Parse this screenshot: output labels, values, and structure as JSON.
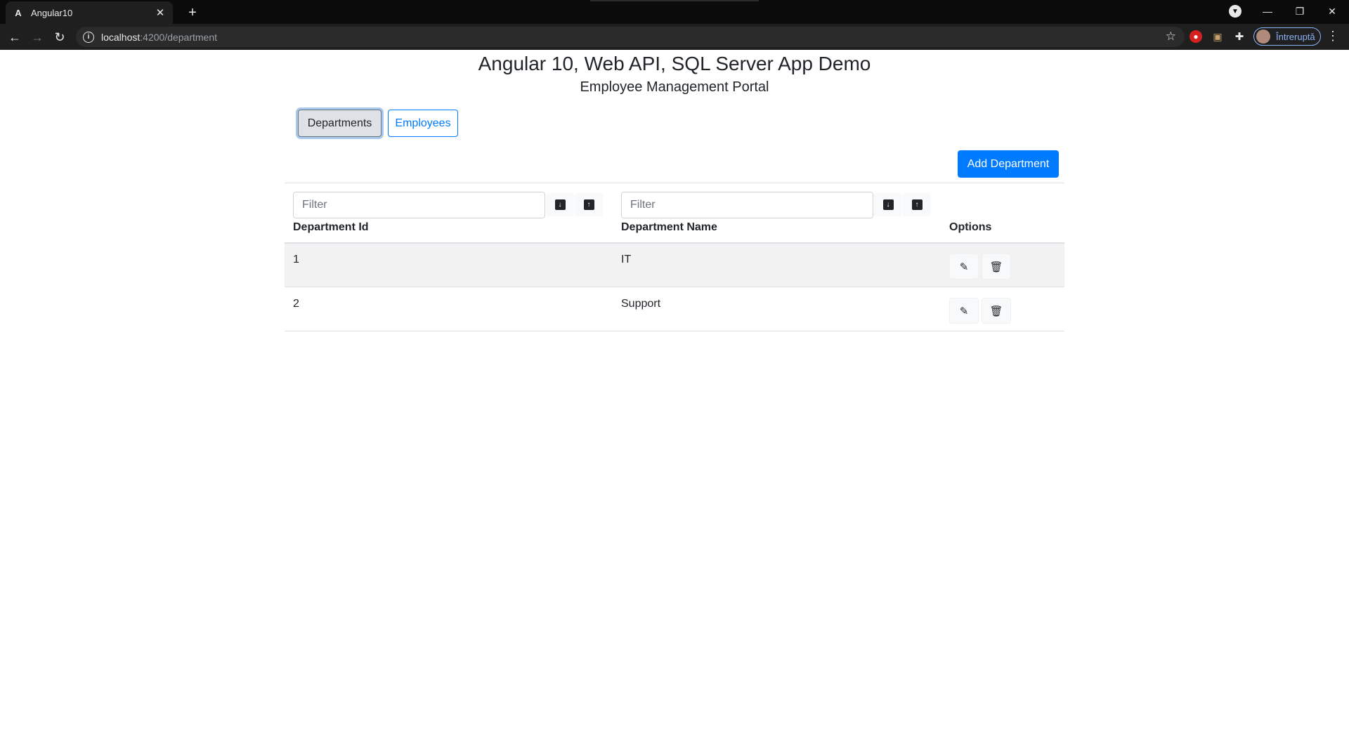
{
  "browser": {
    "tab_title": "Angular10",
    "tab_favicon": "A",
    "url_host": "localhost",
    "url_path": ":4200/department",
    "profile_label": "Întreruptă"
  },
  "page": {
    "title": "Angular 10, Web API, SQL Server App Demo",
    "subtitle": "Employee Management Portal",
    "nav": {
      "departments": "Departments",
      "employees": "Employees"
    },
    "add_button": "Add Department",
    "filters": {
      "id_placeholder": "Filter",
      "name_placeholder": "Filter"
    },
    "columns": {
      "id": "Department Id",
      "name": "Department Name",
      "options": "Options"
    },
    "rows": [
      {
        "id": "1",
        "name": "IT"
      },
      {
        "id": "2",
        "name": "Support"
      }
    ]
  },
  "colors": {
    "primary": "#007bff",
    "chrome_bg": "#1f1f1f",
    "stripe": "#f2f2f2"
  },
  "icons": {
    "sort_desc": "arrow-down-icon",
    "sort_asc": "arrow-up-icon",
    "edit": "edit-icon",
    "delete": "trash-icon"
  }
}
